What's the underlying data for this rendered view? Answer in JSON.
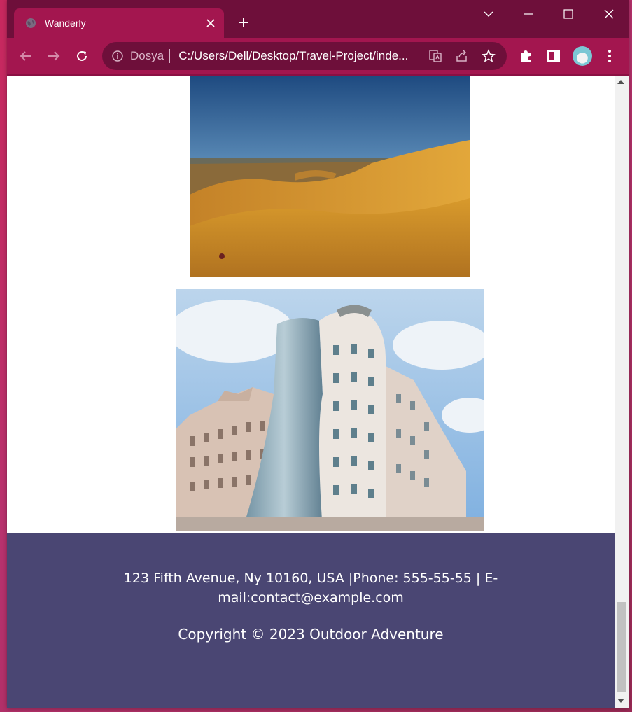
{
  "browser": {
    "tab_title": "Wanderly",
    "site_name": "Dosya",
    "url": "C:/Users/Dell/Desktop/Travel-Project/inde...",
    "accent_color": "#a3164f",
    "frame_color": "#6e0f3a"
  },
  "icons": {
    "tab_icon": "globe-icon",
    "close": "close-icon",
    "new_tab": "plus-icon",
    "back": "back-arrow-icon",
    "forward": "forward-arrow-icon",
    "reload": "reload-icon",
    "site_info": "info-icon",
    "translate": "translate-icon",
    "share": "share-icon",
    "bookmark": "star-icon",
    "extensions": "puzzle-icon",
    "side_panel": "side-panel-icon",
    "menu": "kebab-menu-icon"
  },
  "page": {
    "images": [
      {
        "subject": "desert dunes"
      },
      {
        "subject": "dancing house building"
      }
    ],
    "footer": {
      "address": "123 Fifth Avenue, Ny 10160, USA |Phone: 555-55-55 | E-mail:contact@example.com",
      "copyright": "Copyright © 2023 Outdoor Adventure",
      "background_color": "#4a4673"
    }
  }
}
